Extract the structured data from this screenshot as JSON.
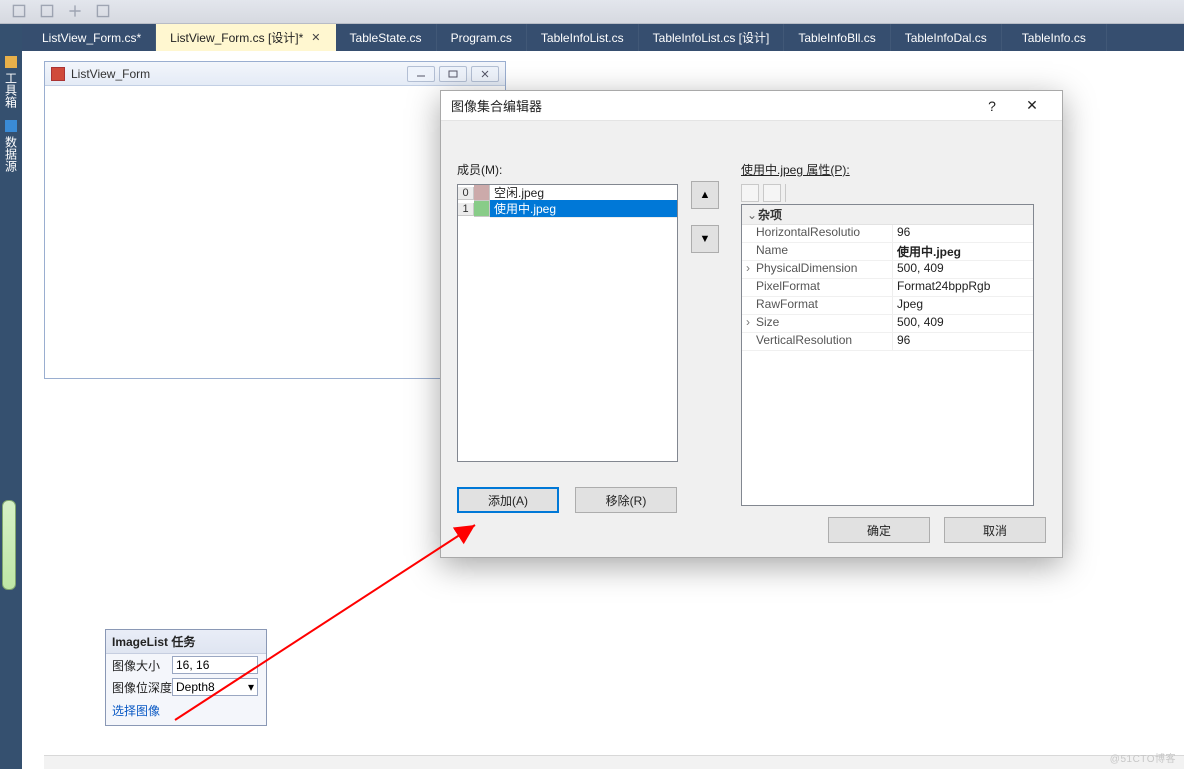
{
  "tabs": [
    {
      "label": "ListView_Form.cs*",
      "active": false
    },
    {
      "label": "ListView_Form.cs [设计]*",
      "active": true
    },
    {
      "label": "TableState.cs",
      "active": false
    },
    {
      "label": "Program.cs",
      "active": false
    },
    {
      "label": "TableInfoList.cs",
      "active": false
    },
    {
      "label": "TableInfoList.cs [设计]",
      "active": false
    },
    {
      "label": "TableInfoBll.cs",
      "active": false
    },
    {
      "label": "TableInfoDal.cs",
      "active": false
    },
    {
      "label": "TableInfo.cs",
      "active": false
    }
  ],
  "left_rail": {
    "item1": "工具箱",
    "item2": "数据源"
  },
  "form_window": {
    "title": "ListView_Form"
  },
  "dialog": {
    "title": "图像集合编辑器",
    "members_label": "成员(M):",
    "props_label_prefix": "使用中.jpeg 属性(P):",
    "members": [
      {
        "index": "0",
        "name": "空闲.jpeg",
        "selected": false
      },
      {
        "index": "1",
        "name": "使用中.jpeg",
        "selected": true
      }
    ],
    "up_glyph": "▲",
    "down_glyph": "▼",
    "add_label": "添加(A)",
    "remove_label": "移除(R)",
    "ok_label": "确定",
    "cancel_label": "取消",
    "help_glyph": "?",
    "close_glyph": "✕",
    "prop_category": "杂项",
    "properties": [
      {
        "exp": "",
        "name": "HorizontalResolutio",
        "value": "96",
        "bold": false
      },
      {
        "exp": "",
        "name": "Name",
        "value": "使用中.jpeg",
        "bold": true
      },
      {
        "exp": "›",
        "name": "PhysicalDimension",
        "value": "500, 409",
        "bold": false
      },
      {
        "exp": "",
        "name": "PixelFormat",
        "value": "Format24bppRgb",
        "bold": false
      },
      {
        "exp": "",
        "name": "RawFormat",
        "value": "Jpeg",
        "bold": false
      },
      {
        "exp": "›",
        "name": "Size",
        "value": "500, 409",
        "bold": false
      },
      {
        "exp": "",
        "name": "VerticalResolution",
        "value": "96",
        "bold": false
      }
    ]
  },
  "smarttag": {
    "title": "ImageList 任务",
    "rows": {
      "size_label": "图像大小",
      "size_value": "16, 16",
      "depth_label": "图像位深度",
      "depth_value": "Depth8"
    },
    "link": "选择图像"
  },
  "watermark": "@51CTO博客"
}
